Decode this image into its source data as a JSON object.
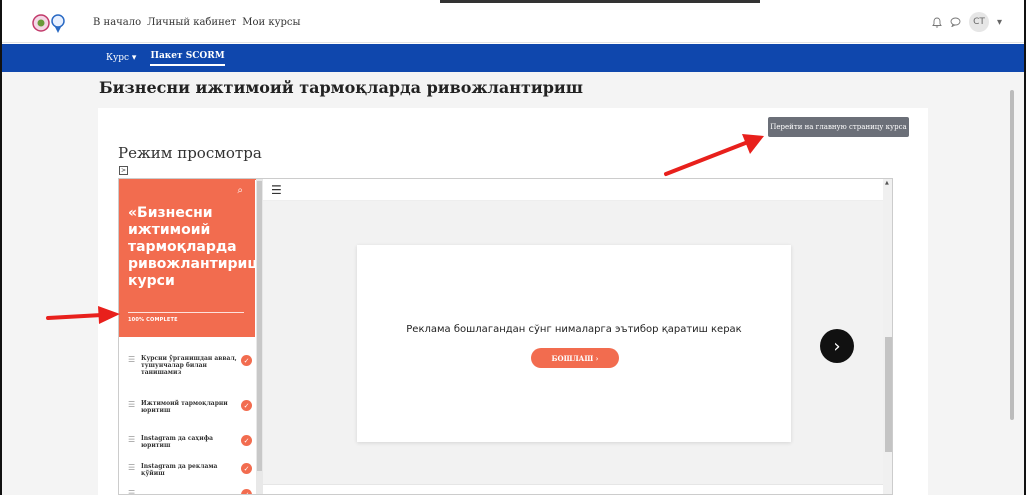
{
  "navbar": {
    "links": [
      "В начало",
      "Личный кабинет",
      "Мои курсы"
    ],
    "avatar_initials": "СТ",
    "bell_icon": "bell-icon",
    "chat_icon": "chat-icon"
  },
  "secondary_nav": {
    "course_menu": "Курс ▾",
    "active_tab": "Пакет SCORM"
  },
  "page": {
    "title": "Бизнесни ижтимоий тармоқларда ривожлантириш"
  },
  "card": {
    "goto_button": "Перейти на главную страницу курса",
    "mode_title": "Режим просмотра",
    "toggle_label": ">"
  },
  "scorm": {
    "sidebar": {
      "title": "«Бизнесни ижтимоий тармоқларда ривожлантириш» курси",
      "progress": "100% COMPLETE",
      "progress_percent": 100,
      "items": [
        {
          "label": "Курсни ўрганишдан аввал, тушунчалар билан танишамиз"
        },
        {
          "label": "Ижтимоий тармоқларни юритиш"
        },
        {
          "label": "Instagram да саҳифа юритиш"
        },
        {
          "label": "Instagram да реклама қўйиш"
        }
      ]
    },
    "lesson": {
      "text": "Реклама бошлагандан сўнг нималарга эътибор қаратиш керак",
      "start_button": "БОШЛАШ"
    }
  },
  "colors": {
    "accent": "#f26c4f",
    "nav_blue": "#0f47ad",
    "annotation_arrow": "#e8201c"
  }
}
